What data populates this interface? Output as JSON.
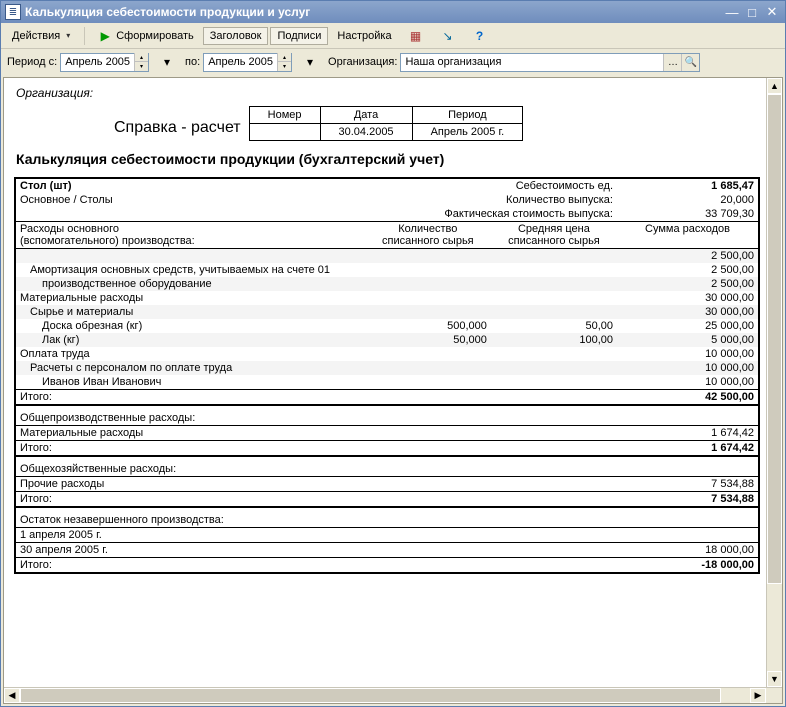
{
  "window": {
    "title": "Калькуляция себестоимости продукции и услуг"
  },
  "toolbar": {
    "actions": "Действия",
    "form": "Сформировать",
    "header": "Заголовок",
    "signatures": "Подписи",
    "settings": "Настройка",
    "help": "?"
  },
  "filter": {
    "period_from_label": "Период с:",
    "period_from": "Апрель 2005",
    "to_label": "по:",
    "period_to": "Апрель 2005",
    "org_label": "Организация:",
    "org": "Наша организация"
  },
  "report": {
    "org_label": "Организация:",
    "spravka": "Справка - расчет",
    "hdr": {
      "num": "Номер",
      "date_h": "Дата",
      "period_h": "Период",
      "date": "30.04.2005",
      "period": "Апрель 2005 г."
    },
    "title": "Калькуляция себестоимости продукции (бухгалтерский учет)",
    "item": {
      "name": "Стол (шт)",
      "group": "Основное / Столы",
      "unit_cost_label": "Себестоимость ед.",
      "unit_cost": "1 685,47",
      "qty_label": "Количество выпуска:",
      "qty": "20,000",
      "fact_label": "Фактическая стоимость выпуска:",
      "fact": "33 709,30"
    },
    "cols": {
      "c1a": "Расходы основного",
      "c1b": "(вспомогательного) производства:",
      "c2a": "Количество",
      "c2b": "списанного сырья",
      "c3a": "Средняя цена",
      "c3b": "списанного сырья",
      "c4": "Сумма расходов"
    },
    "rows": {
      "r1": "",
      "r1v": "2 500,00",
      "r2": "Амортизация основных средств, учитываемых на счете 01",
      "r2v": "2 500,00",
      "r3": "производственное оборудование",
      "r3v": "2 500,00",
      "r4": "Материальные расходы",
      "r4v": "30 000,00",
      "r5": "Сырье и материалы",
      "r5v": "30 000,00",
      "r6": "Доска обрезная (кг)",
      "r6q": "500,000",
      "r6p": "50,00",
      "r6v": "25 000,00",
      "r7": "Лак (кг)",
      "r7q": "50,000",
      "r7p": "100,00",
      "r7v": "5 000,00",
      "r8": "Оплата труда",
      "r8v": "10 000,00",
      "r9": "Расчеты с персоналом по оплате труда",
      "r9v": "10 000,00",
      "r10": "Иванов Иван Иванович",
      "r10v": "10 000,00",
      "itog": "Итого:",
      "itog1": "42 500,00",
      "s2": "Общепроизводственные расходы:",
      "r11": "Материальные расходы",
      "r11v": "1 674,42",
      "itog2": "1 674,42",
      "s3": "Общехозяйственные расходы:",
      "r12": "Прочие расходы",
      "r12v": "7 534,88",
      "itog3": "7 534,88",
      "s4": "Остаток незавершенного производства:",
      "r13": "1 апреля 2005 г.",
      "r13v": "",
      "r14": "30 апреля 2005 г.",
      "r14v": "18 000,00",
      "itog4": "-18 000,00"
    }
  }
}
